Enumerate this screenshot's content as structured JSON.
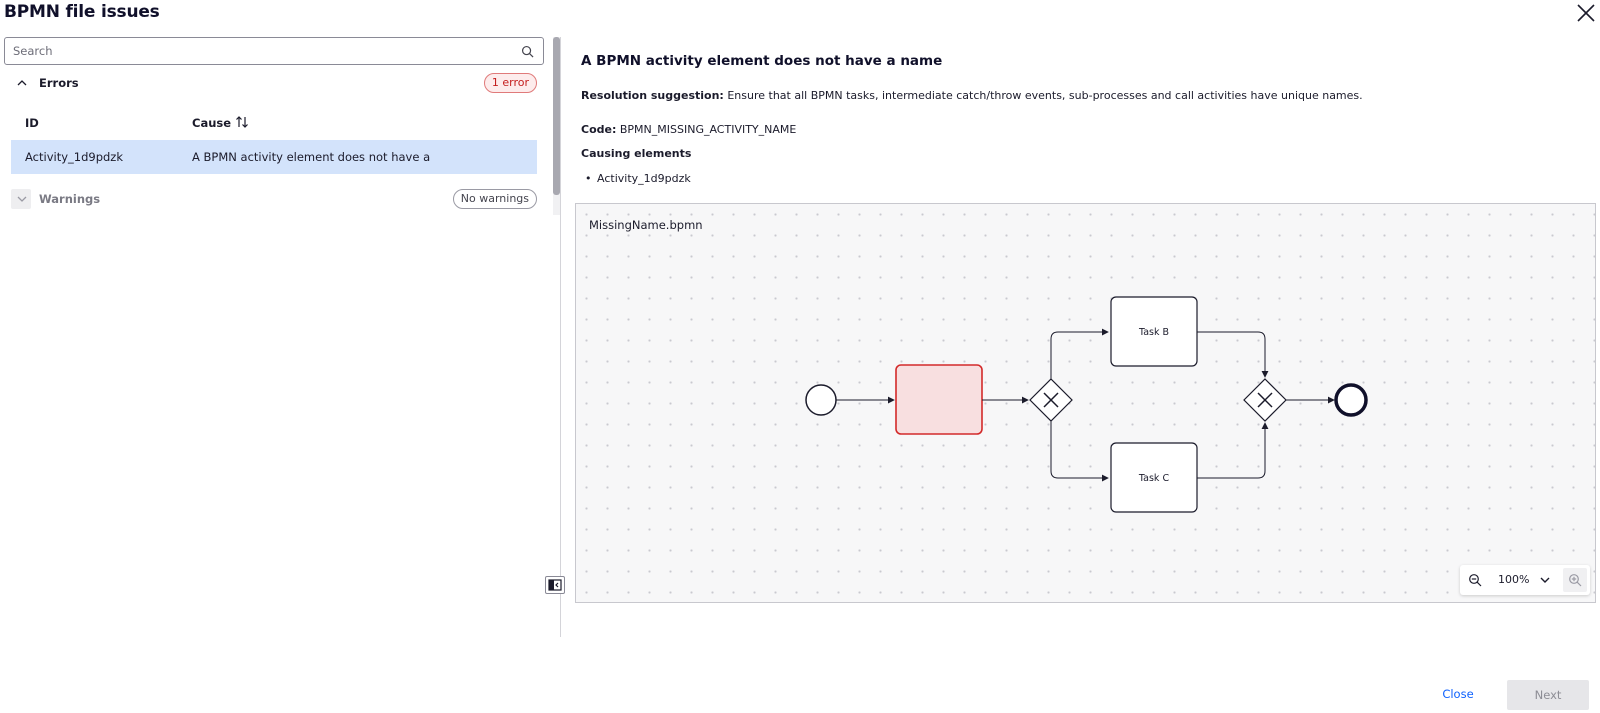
{
  "header": {
    "title": "BPMN file issues",
    "close_icon": "close-icon"
  },
  "search": {
    "placeholder": "Search",
    "value": "",
    "icon": "search-icon"
  },
  "errors_section": {
    "label": "Errors",
    "expanded": true,
    "badge": "1 error",
    "columns": [
      "ID",
      "Cause"
    ],
    "rows": [
      {
        "id": "Activity_1d9pdzk",
        "cause": "A BPMN activity element does not have a",
        "selected": true
      }
    ]
  },
  "warnings_section": {
    "label": "Warnings",
    "expanded": false,
    "badge": "No warnings"
  },
  "detail": {
    "title": "A BPMN activity element does not have a name",
    "resolution_label": "Resolution suggestion:",
    "resolution_text": "Ensure that all BPMN tasks, intermediate catch/throw events, sub-processes and call activities have unique names.",
    "code_label": "Code:",
    "code_value": "BPMN_MISSING_ACTIVITY_NAME",
    "causing_label": "Causing elements",
    "causing_items": [
      "Activity_1d9pdzk"
    ]
  },
  "diagram": {
    "file_name": "MissingName.bpmn",
    "task_b_label": "Task B",
    "task_c_label": "Task C",
    "error_fill": "#f8dfe0",
    "error_stroke": "#d32a2a",
    "stroke": "#1b1b2b"
  },
  "zoom": {
    "level": "100%"
  },
  "footer": {
    "close_label": "Close",
    "next_label": "Next"
  },
  "colors": {
    "accent": "#0f62fe",
    "selected_row": "#d3e3fb",
    "error_text": "#c41d1d"
  }
}
